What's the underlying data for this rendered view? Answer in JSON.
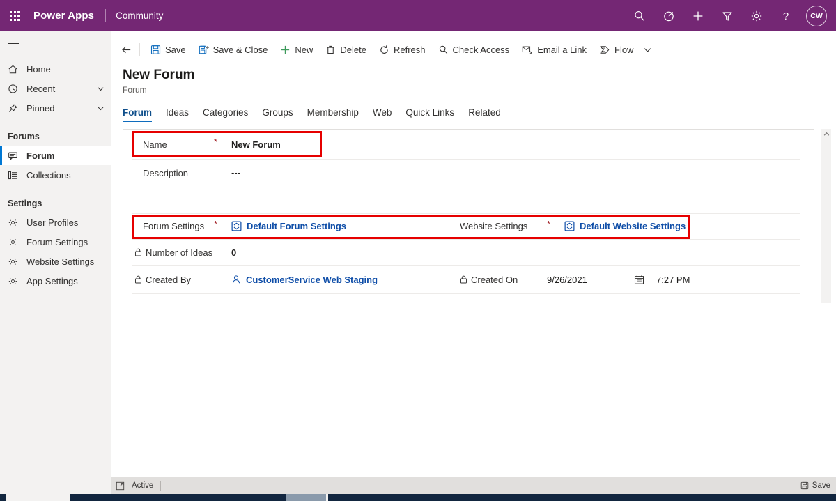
{
  "topbar": {
    "waffle_icon": "waffle-grid-icon",
    "brand": "Power Apps",
    "app_name": "Community",
    "accent_color": "#742774",
    "icons": [
      {
        "name": "search-icon",
        "label": "Search"
      },
      {
        "name": "assistant-icon",
        "label": "Assistant"
      },
      {
        "name": "plus-icon",
        "label": "New"
      },
      {
        "name": "filter-icon",
        "label": "Filter"
      },
      {
        "name": "gear-icon",
        "label": "Settings"
      },
      {
        "name": "help-icon",
        "label": "Help"
      }
    ],
    "avatar_initials": "CW"
  },
  "sidebar": {
    "hamburger_label": "Site Map",
    "items": [
      {
        "label": "Home",
        "icon": "home-icon",
        "chevron": false,
        "selected": false
      },
      {
        "label": "Recent",
        "icon": "clock-icon",
        "chevron": true,
        "selected": false
      },
      {
        "label": "Pinned",
        "icon": "pin-icon",
        "chevron": true,
        "selected": false
      }
    ],
    "groups": [
      {
        "title": "Forums",
        "items": [
          {
            "label": "Forum",
            "icon": "forum-icon",
            "selected": true
          },
          {
            "label": "Collections",
            "icon": "collections-icon",
            "selected": false
          }
        ]
      },
      {
        "title": "Settings",
        "items": [
          {
            "label": "User Profiles",
            "icon": "gear-icon",
            "selected": false
          },
          {
            "label": "Forum Settings",
            "icon": "gear-icon",
            "selected": false
          },
          {
            "label": "Website Settings",
            "icon": "gear-icon",
            "selected": false
          },
          {
            "label": "App Settings",
            "icon": "gear-icon",
            "selected": false
          }
        ]
      }
    ]
  },
  "commandbar": {
    "back_icon": "back-arrow-icon",
    "buttons": [
      {
        "label": "Save",
        "icon": "save-icon"
      },
      {
        "label": "Save & Close",
        "icon": "save-close-icon"
      },
      {
        "label": "New",
        "icon": "plus-icon"
      },
      {
        "label": "Delete",
        "icon": "trash-icon"
      },
      {
        "label": "Refresh",
        "icon": "refresh-icon"
      },
      {
        "label": "Check Access",
        "icon": "key-search-icon"
      },
      {
        "label": "Email a Link",
        "icon": "mail-icon"
      },
      {
        "label": "Flow",
        "icon": "flow-icon"
      }
    ],
    "overflow_icon": "chevron-down-icon"
  },
  "page": {
    "title": "New Forum",
    "subtitle": "Forum",
    "tabs": [
      {
        "label": "Forum",
        "active": true
      },
      {
        "label": "Ideas",
        "active": false
      },
      {
        "label": "Categories",
        "active": false
      },
      {
        "label": "Groups",
        "active": false
      },
      {
        "label": "Membership",
        "active": false
      },
      {
        "label": "Web",
        "active": false
      },
      {
        "label": "Quick Links",
        "active": false
      },
      {
        "label": "Related",
        "active": false
      }
    ]
  },
  "form": {
    "name": {
      "label": "Name",
      "required_marker": "*",
      "value": "New Forum",
      "highlighted": true
    },
    "description": {
      "label": "Description",
      "value": "---"
    },
    "forum_settings": {
      "label": "Forum Settings",
      "required_marker": "*",
      "value": "Default Forum Settings",
      "icon": "lookup-record-icon",
      "highlighted": true
    },
    "website_settings": {
      "label": "Website Settings",
      "required_marker": "*",
      "value": "Default Website Settings",
      "icon": "lookup-record-icon",
      "highlighted": true
    },
    "number_of_ideas": {
      "label": "Number of Ideas",
      "value": "0",
      "readonly_icon": "lock-icon"
    },
    "created_by": {
      "label": "Created By",
      "value": "CustomerService Web Staging",
      "readonly_icon": "lock-icon",
      "icon": "person-icon"
    },
    "created_on": {
      "label": "Created On",
      "date": "9/26/2021",
      "time": "7:27 PM",
      "readonly_icon": "lock-icon",
      "calendar_icon": "calendar-icon"
    },
    "link_color": "#0f4ea8",
    "highlight_color": "#e60000"
  },
  "statusbar": {
    "expand_icon": "expand-icon",
    "status": "Active",
    "save_label": "Save",
    "save_icon": "save-icon"
  },
  "scrollbar": {
    "up_arrow_icon": "chevron-up-icon"
  }
}
